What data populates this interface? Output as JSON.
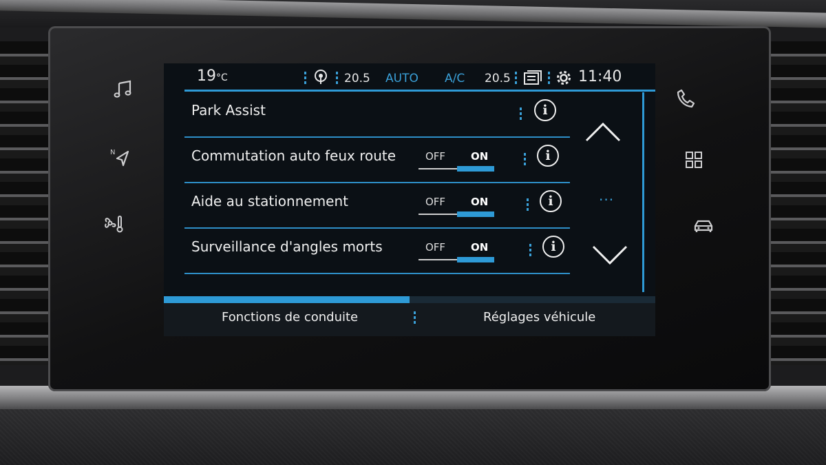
{
  "status_bar": {
    "outside_temp": "19",
    "temp_unit": "°C",
    "left_zone_temp": "20.5",
    "climate_mode": "AUTO",
    "ac_label": "A/C",
    "right_zone_temp": "20.5",
    "clock": "11:40"
  },
  "settings_list": [
    {
      "label": "Park Assist",
      "has_toggle": false
    },
    {
      "label": "Commutation auto feux route",
      "has_toggle": true,
      "off_label": "OFF",
      "on_label": "ON",
      "state": "ON"
    },
    {
      "label": "Aide au stationnement",
      "has_toggle": true,
      "off_label": "OFF",
      "on_label": "ON",
      "state": "ON"
    },
    {
      "label": "Surveillance d'angles morts",
      "has_toggle": true,
      "off_label": "OFF",
      "on_label": "ON",
      "state": "ON"
    }
  ],
  "info_icon_glyph": "i",
  "scroll_indicator": "···",
  "progress_fraction": 0.5,
  "tabs": {
    "left": "Fonctions de conduite",
    "right": "Réglages véhicule"
  },
  "colors": {
    "accent": "#2e9ad6",
    "background": "#0b1015",
    "text": "#f0f0f0"
  },
  "side_buttons_left": [
    "music-icon",
    "navigation-icon",
    "climate-icon"
  ],
  "side_buttons_right": [
    "phone-icon",
    "apps-grid-icon",
    "vehicle-icon"
  ]
}
